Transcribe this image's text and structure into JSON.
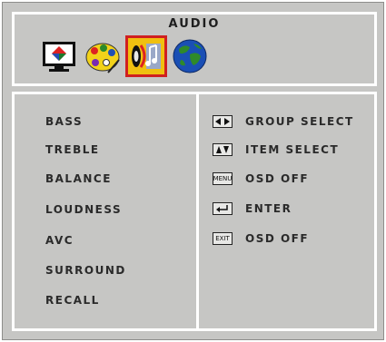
{
  "header": {
    "title": "AUDIO"
  },
  "tabs": [
    {
      "icon": "monitor-picture-icon",
      "selected": false
    },
    {
      "icon": "color-palette-icon",
      "selected": false
    },
    {
      "icon": "audio-speaker-icon",
      "selected": true
    },
    {
      "icon": "globe-icon",
      "selected": false
    }
  ],
  "menu": {
    "items": [
      {
        "label": "BASS"
      },
      {
        "label": "TREBLE"
      },
      {
        "label": "BALANCE"
      },
      {
        "label": "LOUDNESS"
      },
      {
        "label": "AVC"
      },
      {
        "label": "SURROUND"
      },
      {
        "label": "RECALL"
      }
    ]
  },
  "help": {
    "items": [
      {
        "icon": "left-right-arrows-key-icon",
        "key_label": "",
        "text": "GROUP SELECT"
      },
      {
        "icon": "up-down-arrows-key-icon",
        "key_label": "",
        "text": "ITEM SELECT"
      },
      {
        "icon": "menu-key-icon",
        "key_label": "MENU",
        "text": "OSD OFF"
      },
      {
        "icon": "enter-key-icon",
        "key_label": "",
        "text": "ENTER"
      },
      {
        "icon": "exit-key-icon",
        "key_label": "EXIT",
        "text": "OSD OFF"
      }
    ]
  },
  "colors": {
    "background": "#c6c6c4",
    "frame": "#ffffff",
    "text": "#2a2a2a",
    "selected_tab": "#d02020"
  }
}
